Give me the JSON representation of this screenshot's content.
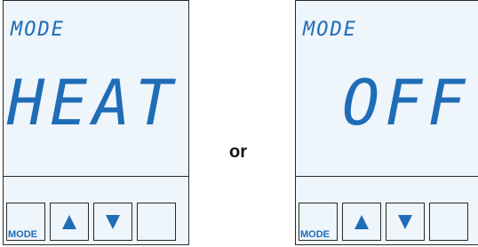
{
  "panels": [
    {
      "header": "MODE",
      "value": "HEAT",
      "buttons": {
        "mode_label": "MODE",
        "up_icon": "up-arrow",
        "down_icon": "down-arrow",
        "blank": ""
      }
    },
    {
      "header": "MODE",
      "value": "OFF",
      "buttons": {
        "mode_label": "MODE",
        "up_icon": "up-arrow",
        "down_icon": "down-arrow",
        "blank": ""
      }
    }
  ],
  "separator_text": "or",
  "colors": {
    "lcd_text": "#1f6cb7",
    "lcd_background": "#eef5fb",
    "border": "#2a2a2a"
  }
}
